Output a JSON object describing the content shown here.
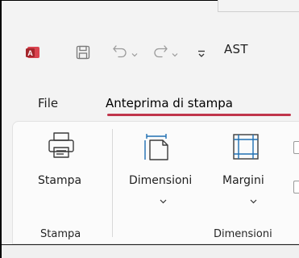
{
  "window": {
    "title_truncated": "AST"
  },
  "quick_access": {
    "icons": [
      "access-app-icon",
      "save-icon",
      "undo-icon",
      "redo-icon",
      "customize-qat-icon"
    ]
  },
  "tabs": [
    {
      "label": "File"
    },
    {
      "label": "Anteprima di stampa",
      "active": true
    }
  ],
  "ribbon": {
    "groups": [
      {
        "label": "Stampa",
        "buttons": [
          {
            "label": "Stampa",
            "icon": "printer-icon"
          }
        ]
      },
      {
        "label": "Dimensioni",
        "buttons": [
          {
            "label": "Dimensioni",
            "icon": "page-size-icon",
            "has_dropdown": true
          },
          {
            "label": "Margini",
            "icon": "margins-icon",
            "has_dropdown": true
          }
        ]
      }
    ]
  },
  "colors": {
    "accent": "#c0354b",
    "access_red": "#b7323e",
    "icon_blue": "#1f6fb2"
  }
}
